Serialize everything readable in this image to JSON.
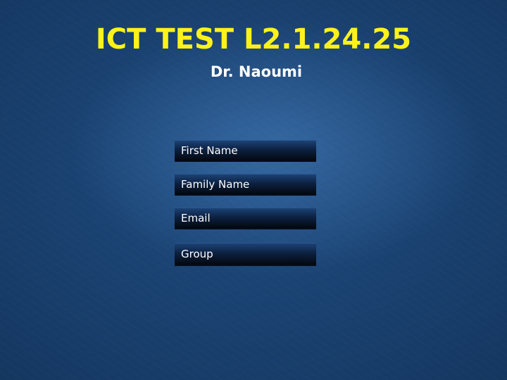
{
  "header": {
    "title": "ICT TEST L2.1.24.25",
    "subtitle": "Dr. Naoumi"
  },
  "form": {
    "fields": [
      {
        "placeholder": "First Name",
        "value": ""
      },
      {
        "placeholder": "Family Name",
        "value": ""
      },
      {
        "placeholder": "Email",
        "value": ""
      },
      {
        "placeholder": "Group",
        "value": ""
      }
    ]
  },
  "colors": {
    "title": "#fff21a",
    "subtitle": "#ffffff",
    "background": "#173c68",
    "field_top": "#1c4275",
    "field_bottom": "#03080f"
  }
}
